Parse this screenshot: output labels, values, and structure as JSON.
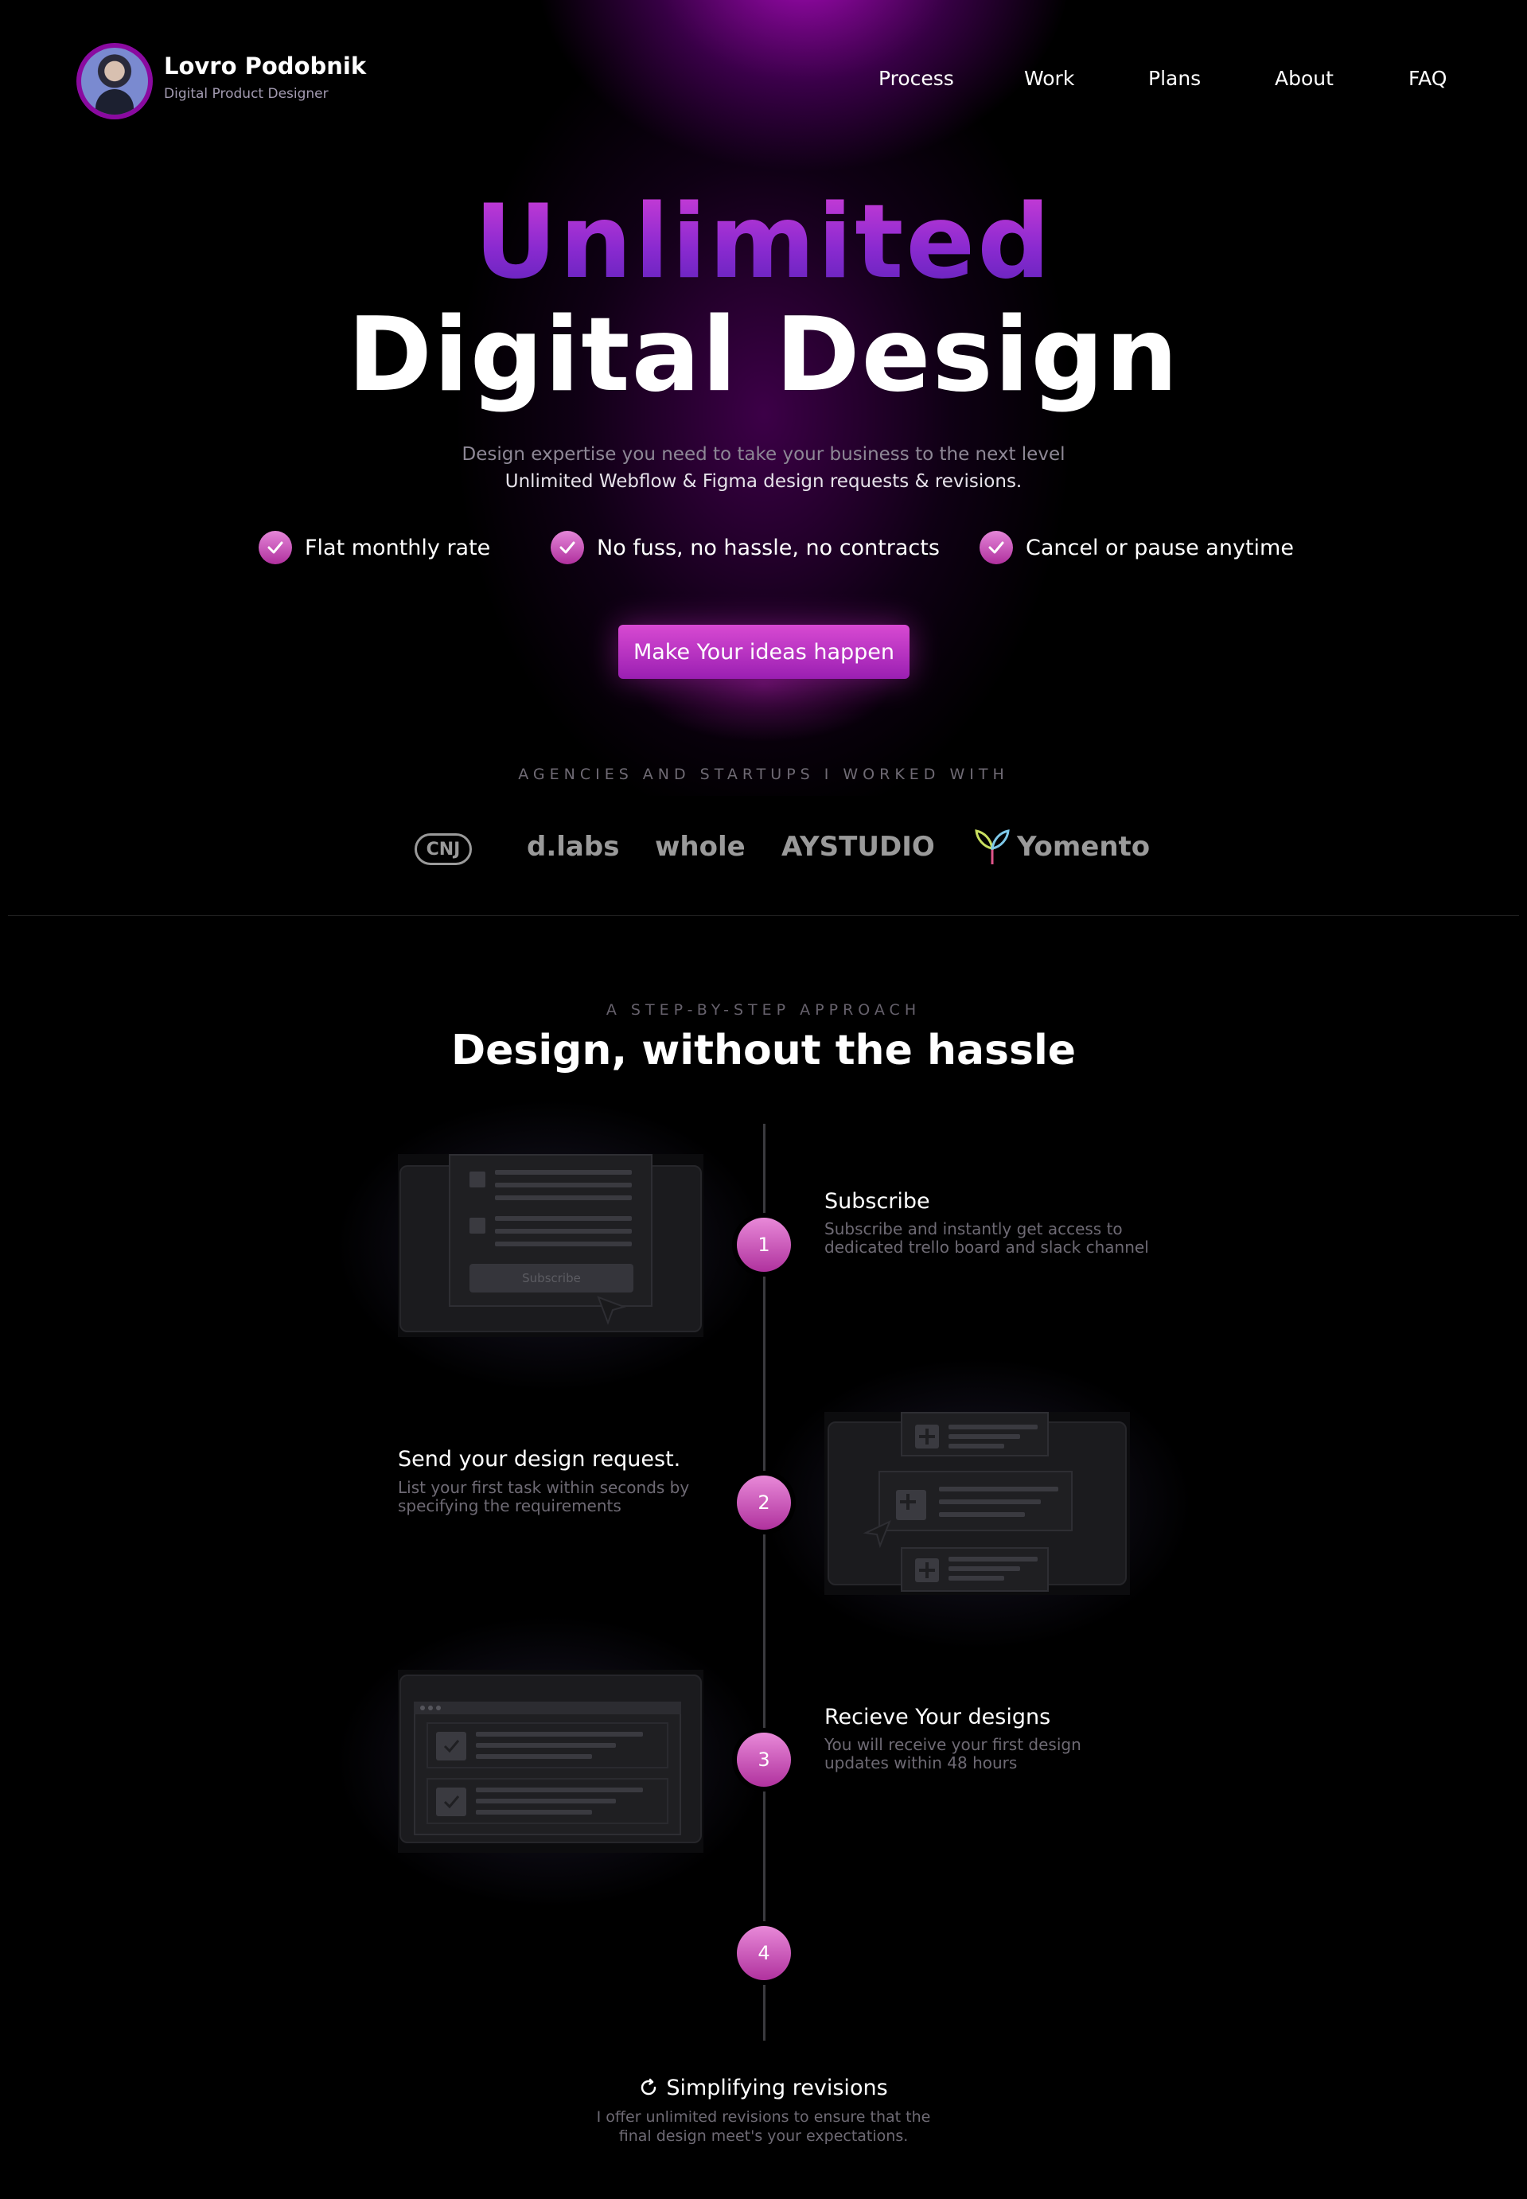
{
  "header": {
    "name": "Lovro Podobnik",
    "subtitle": "Digital Product Designer",
    "nav": [
      "Process",
      "Work",
      "Plans",
      "About",
      "FAQ"
    ]
  },
  "hero": {
    "line1": "Unlimited",
    "line2": "Digital Design",
    "sub1": "Design expertise you need to take your business to the next level",
    "sub2": "Unlimited Webflow & Figma design requests & revisions.",
    "features": [
      "Flat monthly rate",
      "No fuss, no hassle, no contracts",
      "Cancel or pause anytime"
    ],
    "cta": "Make Your ideas happen"
  },
  "agencies": {
    "heading": "AGENCIES AND STARTUPS I WORKED WITH",
    "logos": [
      "CNJ",
      "d.labs",
      "whole",
      "AYSTUDIO",
      "Yomento"
    ]
  },
  "process": {
    "eyebrow": "A STEP-BY-STEP APPROACH",
    "title": "Design, without the hassle",
    "steps": [
      {
        "num": "1",
        "title": "Subscribe",
        "desc": "Subscribe and instantly get access to dedicated trello board and slack channel"
      },
      {
        "num": "2",
        "title": "Send your design request.",
        "desc": "List your first task within seconds by specifying the requirements"
      },
      {
        "num": "3",
        "title": "Recieve Your designs",
        "desc": "You will receive your first design updates within 48 hours"
      },
      {
        "num": "4"
      }
    ],
    "subscribe_button": "Subscribe",
    "revisions_title": "Simplifying revisions",
    "revisions_desc_1": "I offer unlimited revisions to ensure that the",
    "revisions_desc_2": "final design meet's your expectations."
  },
  "colors": {
    "accent_pink": "#d84ad2",
    "accent_purple": "#9a1fb2",
    "background": "#000000"
  }
}
